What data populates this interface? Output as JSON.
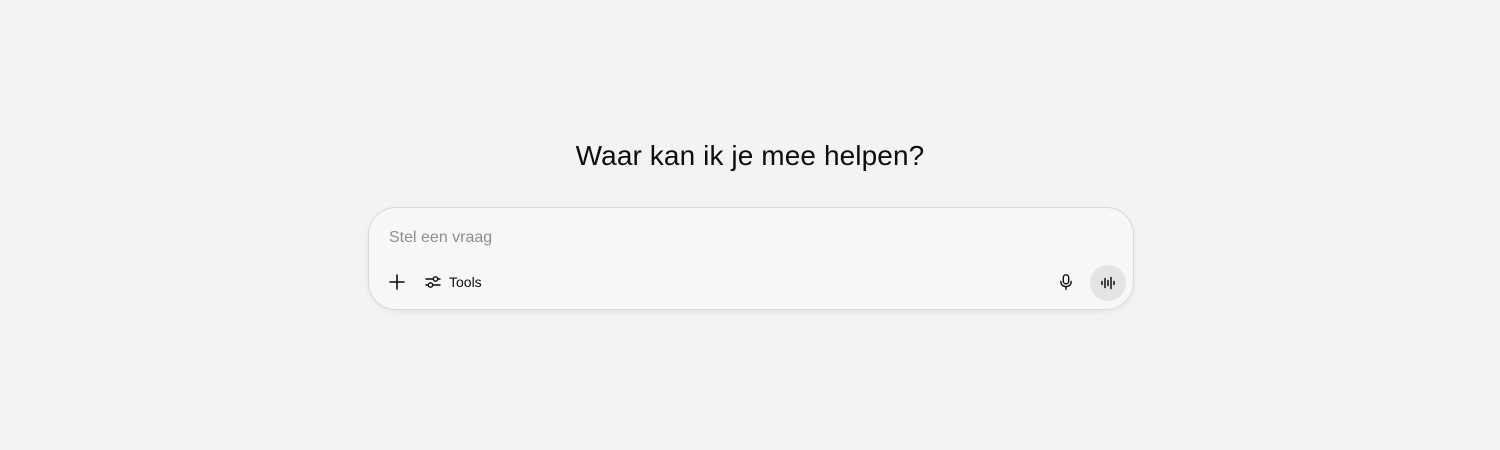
{
  "main": {
    "title": "Waar kan ik je mee helpen?"
  },
  "composer": {
    "input_placeholder": "Stel een vraag",
    "input_value": "",
    "tools_label": "Tools",
    "icons": {
      "attach": "plus-icon",
      "tools": "sliders-icon",
      "dictate": "microphone-icon",
      "voice_mode": "waveform-icon"
    }
  },
  "colors": {
    "background": "#f3f3f3",
    "composer_bg": "#f7f7f7",
    "composer_border": "#d9d9d9",
    "voice_button_bg": "#e4e4e4",
    "placeholder": "#8f8f8f"
  }
}
